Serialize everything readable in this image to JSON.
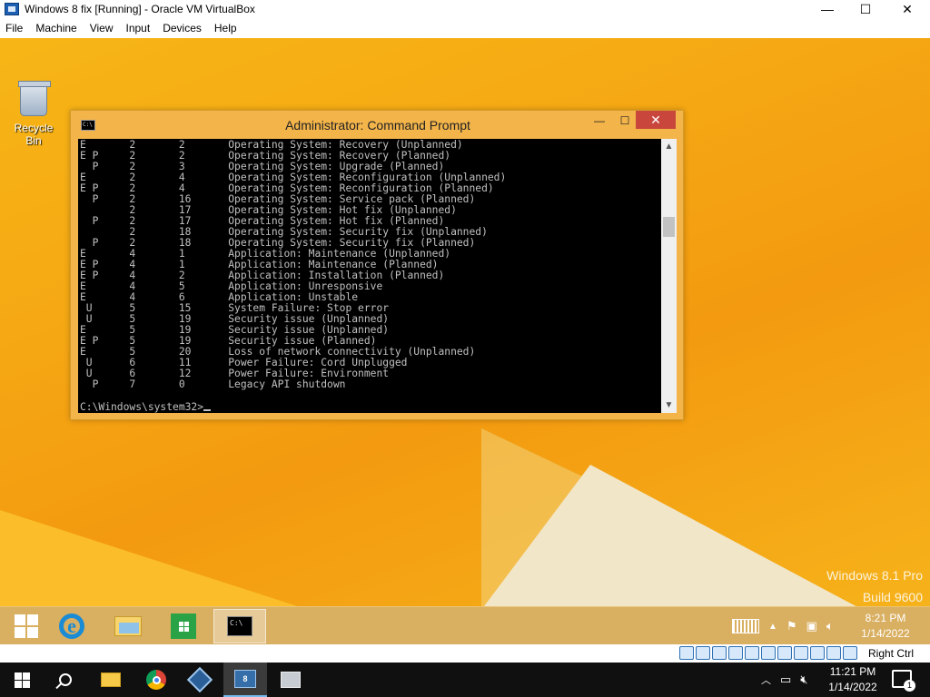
{
  "host_window": {
    "title": "Windows 8 fix [Running] - Oracle VM VirtualBox",
    "controls": {
      "minimize": "—",
      "maximize": "☐",
      "close": "✕"
    }
  },
  "menu": [
    "File",
    "Machine",
    "View",
    "Input",
    "Devices",
    "Help"
  ],
  "desktop": {
    "recycle_bin_label": "Recycle Bin",
    "watermark": {
      "line1": "Windows 8.1 Pro",
      "line2": "Build 9600"
    }
  },
  "cmd_window": {
    "title": "Administrator: Command Prompt",
    "icon_text": "C:\\",
    "controls": {
      "minimize": "—",
      "maximize": "☐",
      "close": "✕"
    },
    "lines": [
      "E       2       2       Operating System: Recovery (Unplanned)",
      "E P     2       2       Operating System: Recovery (Planned)",
      "  P     2       3       Operating System: Upgrade (Planned)",
      "E       2       4       Operating System: Reconfiguration (Unplanned)",
      "E P     2       4       Operating System: Reconfiguration (Planned)",
      "  P     2       16      Operating System: Service pack (Planned)",
      "        2       17      Operating System: Hot fix (Unplanned)",
      "  P     2       17      Operating System: Hot fix (Planned)",
      "        2       18      Operating System: Security fix (Unplanned)",
      "  P     2       18      Operating System: Security fix (Planned)",
      "E       4       1       Application: Maintenance (Unplanned)",
      "E P     4       1       Application: Maintenance (Planned)",
      "E P     4       2       Application: Installation (Planned)",
      "E       4       5       Application: Unresponsive",
      "E       4       6       Application: Unstable",
      " U      5       15      System Failure: Stop error",
      " U      5       19      Security issue (Unplanned)",
      "E       5       19      Security issue (Unplanned)",
      "E P     5       19      Security issue (Planned)",
      "E       5       20      Loss of network connectivity (Unplanned)",
      " U      6       11      Power Failure: Cord Unplugged",
      " U      6       12      Power Failure: Environment",
      "  P     7       0       Legacy API shutdown",
      ""
    ],
    "prompt": "C:\\Windows\\system32>",
    "scroll_position": 0.28
  },
  "guest_taskbar": {
    "items": [
      "start-button",
      "internet-explorer",
      "file-explorer",
      "windows-store",
      "command-prompt"
    ],
    "clock_time": "8:21 PM",
    "clock_date": "1/14/2022"
  },
  "vbox_status": {
    "host_key": "Right Ctrl"
  },
  "host_taskbar": {
    "clock_time": "11:21 PM",
    "clock_date": "1/14/2022",
    "notification_count": "1"
  }
}
